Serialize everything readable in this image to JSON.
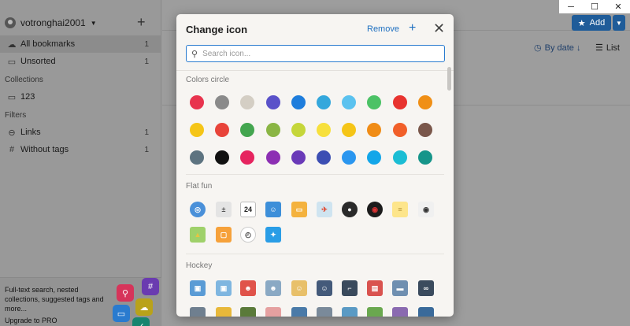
{
  "window": {
    "add_label": "Add"
  },
  "sidebar": {
    "username": "votronghai2001",
    "items": [
      {
        "label": "All bookmarks",
        "count": "1"
      },
      {
        "label": "Unsorted",
        "count": "1"
      }
    ],
    "collections_heading": "Collections",
    "collections": [
      {
        "label": "123"
      }
    ],
    "filters_heading": "Filters",
    "filters": [
      {
        "label": "Links",
        "count": "1"
      },
      {
        "label": "Without tags",
        "count": "1"
      }
    ],
    "promo": {
      "text": "Full-text search, nested collections, suggested tags and more...",
      "upgrade": "Upgrade to PRO"
    }
  },
  "toolbar": {
    "sort_label": "By date ↓",
    "view_label": "List"
  },
  "modal": {
    "title": "Change icon",
    "remove_label": "Remove",
    "search_placeholder": "Search icon...",
    "sections": {
      "colors": "Colors circle",
      "flat": "Flat fun",
      "hockey": "Hockey"
    },
    "calendar_day": "24",
    "colors_circle": [
      [
        "#e8344e",
        "#8a8a8a",
        "#d4cec4",
        "#5a52c9",
        "#1e7ddc",
        "#34a7dc",
        "#5bc2ef",
        "#4cc266",
        "#e8332f",
        "#f08f16"
      ],
      [
        "#f5c517",
        "#e8443a",
        "#43a54f",
        "#8ab544",
        "#c5d63a",
        "#f7e03c",
        "#f5c517",
        "#f08c16",
        "#f15f29",
        "#7a574b"
      ],
      [
        "#5d7380",
        "#111111",
        "#e6245f",
        "#8c2fb3",
        "#6a3ab8",
        "#3c4eb3",
        "#2a96ef",
        "#13a6e9",
        "#1bbdd4",
        "#16958a"
      ]
    ]
  }
}
